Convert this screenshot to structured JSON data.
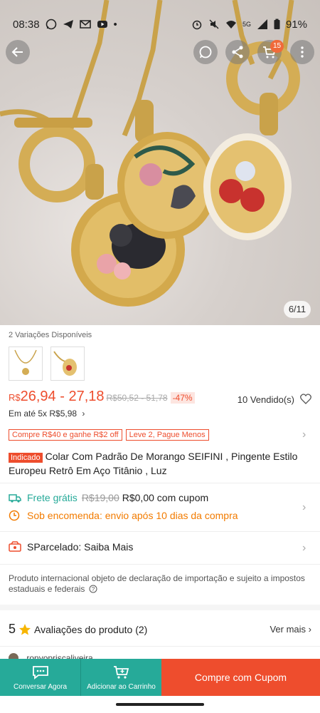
{
  "status_bar": {
    "time": "08:38",
    "network": "5G",
    "battery": "91%"
  },
  "top_bar": {
    "cart_count": "15"
  },
  "gallery": {
    "page_indicator": "6/11"
  },
  "variations": {
    "label": "2 Variações Disponíveis"
  },
  "price": {
    "currency": "R$",
    "range": "26,94 - 27,18",
    "original": "R$50,52 - 51,78",
    "discount": "-47%",
    "sold": "10 Vendido(s)",
    "installment": "Em até 5x R$5,98"
  },
  "promo_tags": [
    "Compre R$40 e ganhe R$2 off",
    "Leve 2, Pague Menos"
  ],
  "product": {
    "badge": "Indicado",
    "title": "Colar Com Padrão De Morango SEIFINI , Pingente Estilo Europeu Retrô Em Aço Titânio , Luz"
  },
  "shipping": {
    "label": "Frete grátis",
    "old": "R$19,00",
    "new": "R$0,00 com cupom",
    "preorder": "Sob encomenda: envio após 10 dias da compra"
  },
  "parcelado": {
    "label": "SParcelado: Saiba Mais"
  },
  "disclaimer": "Produto internacional objeto de declaração de importação e sujeito a impostos estaduais e federais",
  "reviews": {
    "score": "5",
    "label": "Avaliações do produto (2)",
    "more": "Ver mais"
  },
  "reviewer": {
    "name": "ronyopriscaliveira"
  },
  "bottom_bar": {
    "chat": "Conversar Agora",
    "add_cart": "Adicionar ao Carrinho",
    "buy": "Compre com Cupom"
  },
  "colors": {
    "brand": "#ee4d2d",
    "teal": "#26aa99",
    "orange": "#f27b00"
  }
}
